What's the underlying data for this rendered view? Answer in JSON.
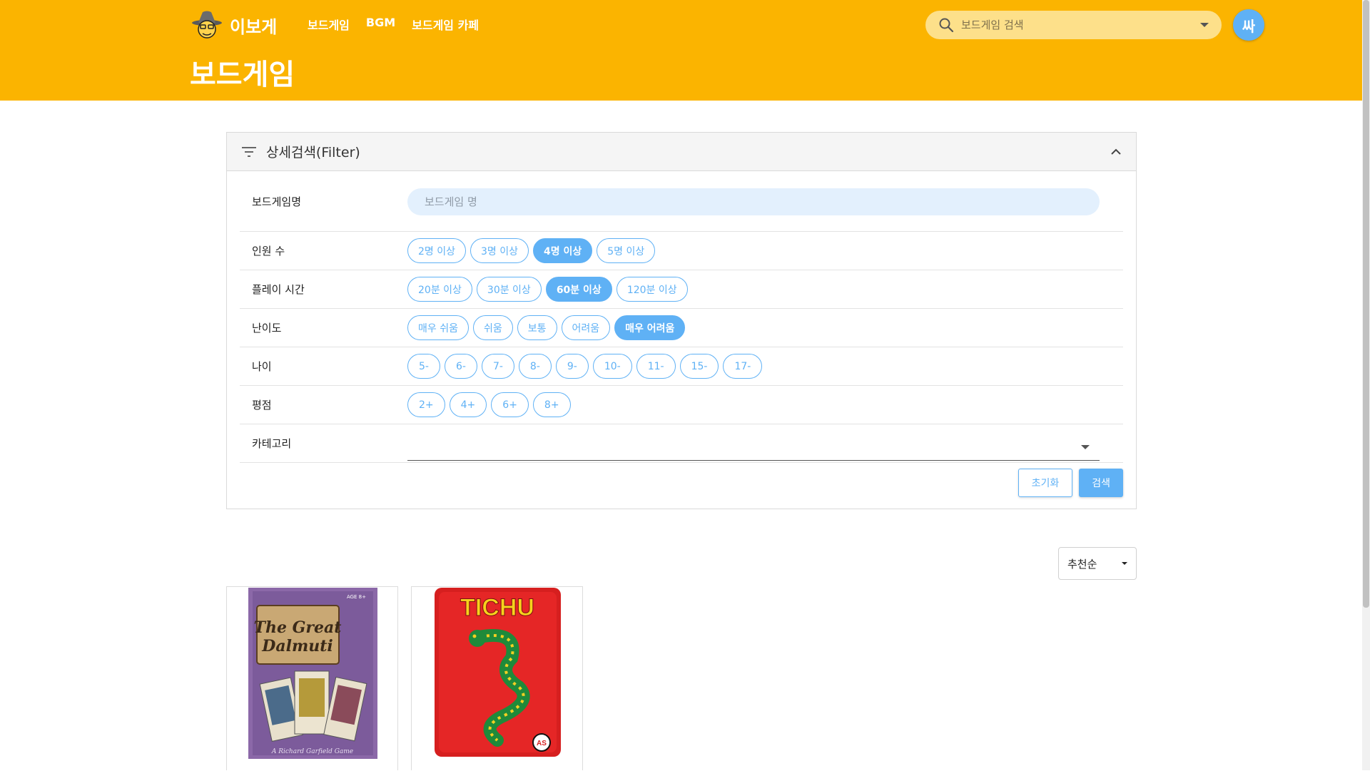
{
  "header": {
    "logo_text": "이보게",
    "nav": [
      "보드게임",
      "BGM",
      "보드게임 카페"
    ],
    "page_title": "보드게임",
    "search_placeholder": "보드게임 검색",
    "avatar_text": "싸"
  },
  "filter": {
    "title": "상세검색(Filter)",
    "rows": {
      "name": {
        "label": "보드게임명",
        "placeholder": "보드게임 명"
      },
      "players": {
        "label": "인원 수",
        "options": [
          "2명 이상",
          "3명 이상",
          "4명 이상",
          "5명 이상"
        ],
        "selected": "4명 이상"
      },
      "playtime": {
        "label": "플레이 시간",
        "options": [
          "20분 이상",
          "30분 이상",
          "60분 이상",
          "120분 이상"
        ],
        "selected": "60분 이상"
      },
      "difficulty": {
        "label": "난이도",
        "options": [
          "매우 쉬움",
          "쉬움",
          "보통",
          "어려움",
          "매우 어려움"
        ],
        "selected": "매우 어려움"
      },
      "age": {
        "label": "나이",
        "options": [
          "5-",
          "6-",
          "7-",
          "8-",
          "9-",
          "10-",
          "11-",
          "15-",
          "17-"
        ]
      },
      "rating": {
        "label": "평점",
        "options": [
          "2+",
          "4+",
          "6+",
          "8+"
        ]
      },
      "category": {
        "label": "카테고리",
        "value": ""
      }
    },
    "reset_label": "초기화",
    "search_label": "검색"
  },
  "sort": {
    "value": "추천순"
  },
  "games": [
    {
      "title_lines": [
        "The Great",
        "Dalmuti"
      ],
      "age_badge": "AGE 8+",
      "author": "A Richard Garfield Game"
    },
    {
      "title": "TICHU",
      "publisher_badge": "AS"
    }
  ],
  "colors": {
    "header": "#fbb400",
    "accent": "#5fb1f5"
  }
}
